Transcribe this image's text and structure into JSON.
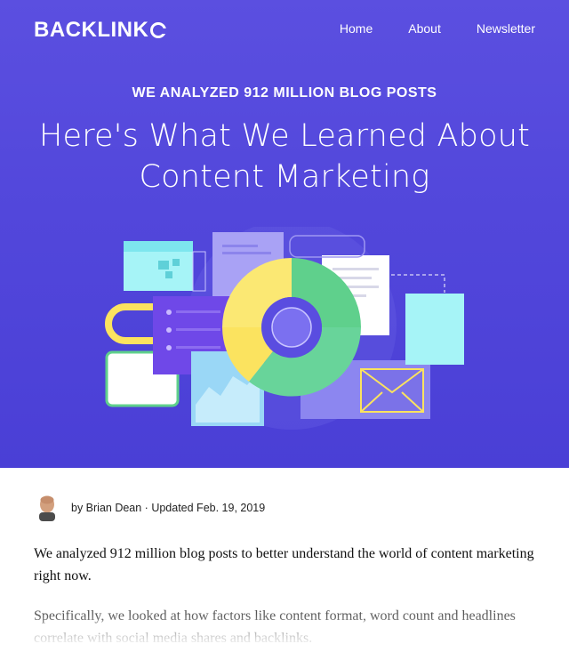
{
  "header": {
    "logo_text": "BACKLINK",
    "nav": [
      {
        "label": "Home"
      },
      {
        "label": "About"
      },
      {
        "label": "Newsletter"
      }
    ]
  },
  "hero": {
    "kicker": "WE ANALYZED 912 MILLION BLOG POSTS",
    "headline_line1": "Here's What We Learned About",
    "headline_line2": "Content Marketing"
  },
  "byline": {
    "text": "by Brian Dean · Updated Feb. 19, 2019"
  },
  "article": {
    "intro": "We analyzed 912 million blog posts to better understand the world of content marketing right now.",
    "paragraph2": "Specifically, we looked at how factors like content format, word count and headlines correlate with social media shares and backlinks."
  },
  "colors": {
    "hero_bg": "#5247db",
    "donut_yellow": "#fbe35f",
    "donut_green": "#5fd08c",
    "cyan": "#a6f4f7"
  }
}
